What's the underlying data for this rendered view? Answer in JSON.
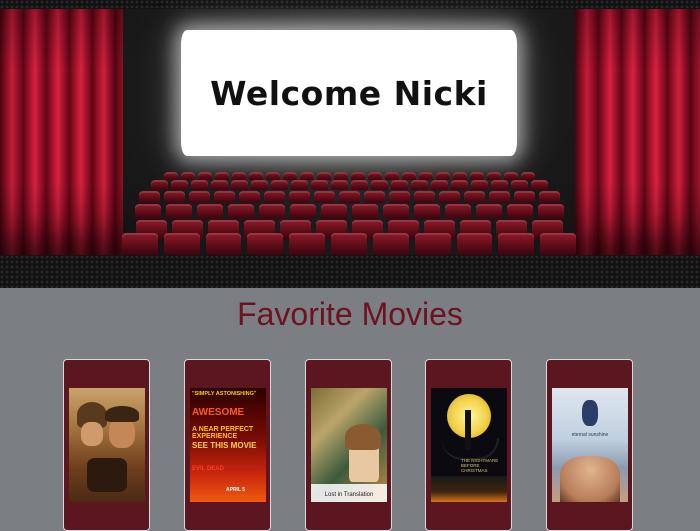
{
  "banner": {
    "welcome_text": "Welcome Nicki"
  },
  "favorites": {
    "title": "Favorite Movies",
    "posters": [
      {
        "name": "poster-indiana-jones",
        "caption": ""
      },
      {
        "name": "poster-evil-dead",
        "lines": [
          "\"SIMPLY ASTONISHING\"",
          "AWESOME",
          "A NEAR PERFECT EXPERIENCE",
          "SEE THIS MOVIE"
        ],
        "bottom": "EVIL DEAD",
        "date": "APRIL 5"
      },
      {
        "name": "poster-lost-in-translation",
        "caption": "Lost in Translation"
      },
      {
        "name": "poster-nightmare-before-christmas",
        "caption": "THE NIGHTMARE BEFORE CHRISTMAS"
      },
      {
        "name": "poster-eternal-sunshine",
        "caption": "eternal sunshine"
      }
    ]
  },
  "colors": {
    "accent": "#6d1220",
    "card_bg": "#5c1620",
    "page_bg": "#7b7f83"
  }
}
